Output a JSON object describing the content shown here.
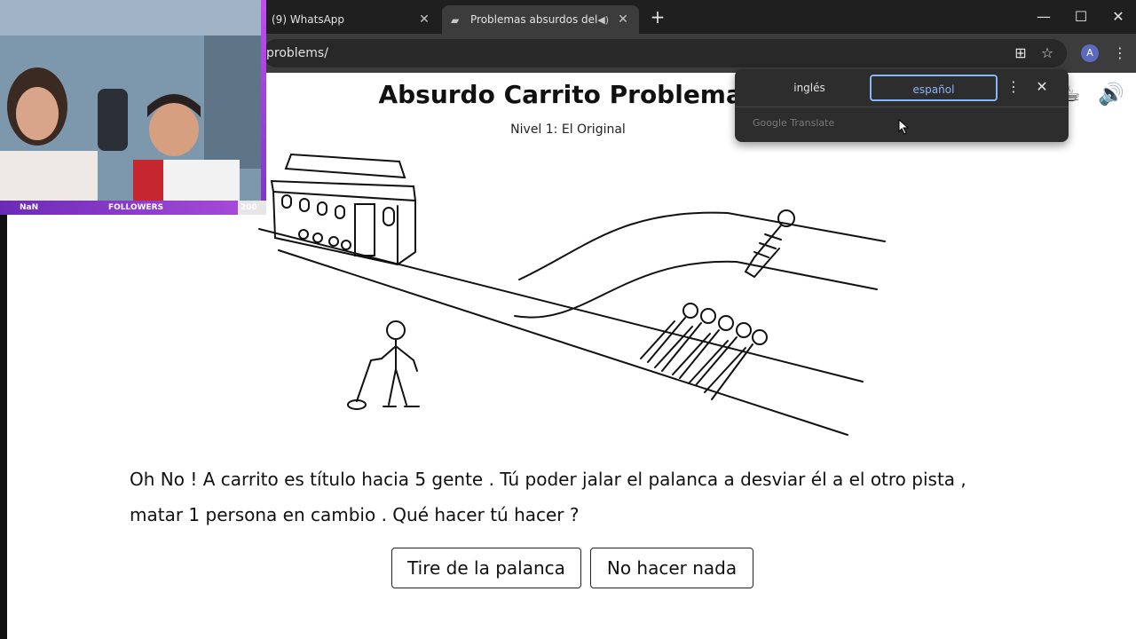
{
  "browser": {
    "tabs": [
      {
        "title": "(9) WhatsApp",
        "active": false
      },
      {
        "title": "Problemas absurdos del tra",
        "active": true
      }
    ],
    "url": "problems/",
    "profile_initial": "A"
  },
  "page": {
    "title": "Absurdo Carrito Problemas",
    "level": "Nivel 1: El Original",
    "question_line1": "Oh No ! A carrito es título hacia 5 gente . Tú poder jalar el palanca a desviar él a el otro pista ,",
    "question_line2": "matar 1 persona en cambio . Qué hacer tú hacer ?",
    "buttons": {
      "pull": "Tire de la palanca",
      "nothing": "No hacer nada"
    }
  },
  "translate_popup": {
    "source_lang": "inglés",
    "target_lang": "español",
    "brand": "Google Translate"
  },
  "webcam_overlay": {
    "left_label": "NaN",
    "center_label": "FOLLOWERS",
    "right_label": "200"
  },
  "colors": {
    "accent": "#8ab4f8",
    "chrome_dark": "#1f1f1f",
    "overlay_purple": "#a44ad8"
  }
}
